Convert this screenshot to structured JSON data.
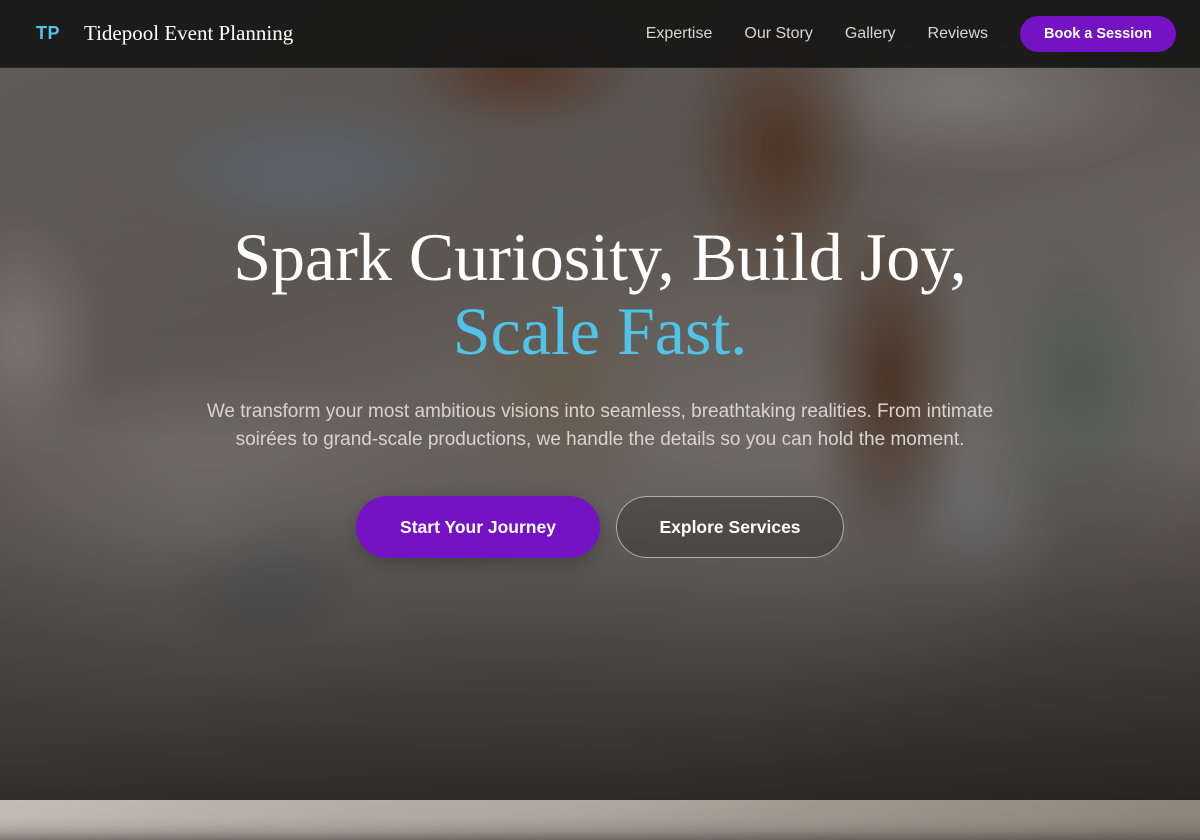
{
  "brand": {
    "logo_text": "TP",
    "name": "Tidepool Event Planning"
  },
  "nav": {
    "links": [
      {
        "label": "Expertise"
      },
      {
        "label": "Our Story"
      },
      {
        "label": "Gallery"
      },
      {
        "label": "Reviews"
      }
    ],
    "cta_label": "Book a Session"
  },
  "hero": {
    "headline_line1": "Spark Curiosity, Build Joy,",
    "headline_line2": "Scale Fast.",
    "subtext": "We transform your most ambitious visions into seamless, breathtaking realities. From intimate soirées to grand-scale productions, we handle the details so you can hold the moment.",
    "primary_cta": "Start Your Journey",
    "secondary_cta": "Explore Services",
    "background_image": "blurred banquet table with flowers"
  },
  "colors": {
    "accent": "#4fc3e8",
    "brand_purple": "#7412c4",
    "nav_background": "#161616"
  }
}
